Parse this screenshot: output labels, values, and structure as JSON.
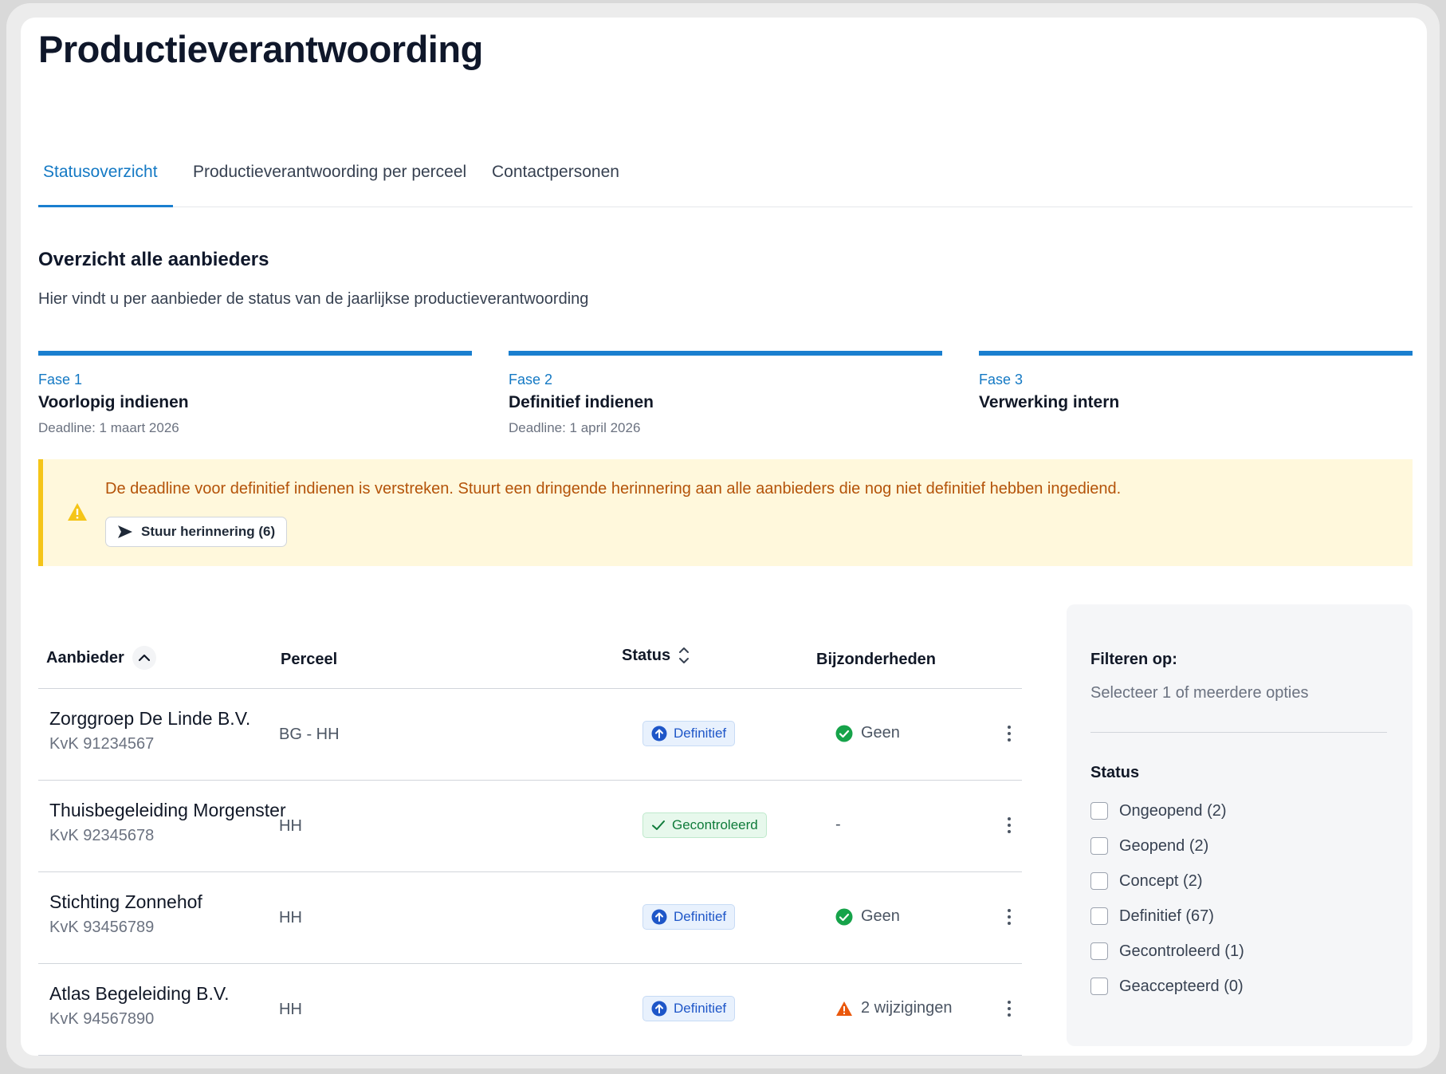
{
  "page": {
    "title": "Productieverantwoording"
  },
  "tabs": [
    {
      "label": "Statusoverzicht",
      "active": true
    },
    {
      "label": "Productieverantwoording per perceel",
      "active": false
    },
    {
      "label": "Contactpersonen",
      "active": false
    }
  ],
  "section": {
    "title": "Overzicht alle aanbieders",
    "subtitle": "Hier vindt u per aanbieder de status van de jaarlijkse productieverantwoording"
  },
  "phases": [
    {
      "label": "Fase 1",
      "name": "Voorlopig indienen",
      "deadline": "Deadline: 1 maart 2026"
    },
    {
      "label": "Fase 2",
      "name": "Definitief indienen",
      "deadline": "Deadline: 1 april 2026"
    },
    {
      "label": "Fase 3",
      "name": "Verwerking intern",
      "deadline": ""
    }
  ],
  "alert": {
    "text": "De deadline voor definitief indienen is verstreken. Stuurt een dringende herinnering aan alle aanbieders die nog niet definitief hebben ingediend.",
    "button_label": "Stuur herinnering (6)"
  },
  "table": {
    "headers": {
      "aanbieder": "Aanbieder",
      "perceel": "Perceel",
      "status": "Status",
      "bijzonderheden": "Bijzonderheden"
    },
    "rows": [
      {
        "name": "Zorggroep De Linde B.V.",
        "kvk": "KvK 91234567",
        "perceel": "BG - HH",
        "status": "Definitief",
        "status_type": "definitief",
        "bijzonderheden": "Geen",
        "bij_type": "ok"
      },
      {
        "name": "Thuisbegeleiding Morgenster",
        "kvk": "KvK 92345678",
        "perceel": "HH",
        "status": "Gecontroleerd",
        "status_type": "gecontroleerd",
        "bijzonderheden": "-",
        "bij_type": "none"
      },
      {
        "name": "Stichting Zonnehof",
        "kvk": "KvK 93456789",
        "perceel": "HH",
        "status": "Definitief",
        "status_type": "definitief",
        "bijzonderheden": "Geen",
        "bij_type": "ok"
      },
      {
        "name": "Atlas Begeleiding B.V.",
        "kvk": "KvK 94567890",
        "perceel": "HH",
        "status": "Definitief",
        "status_type": "definitief",
        "bijzonderheden": "2 wijzigingen",
        "bij_type": "warning"
      }
    ]
  },
  "filter": {
    "title": "Filteren op:",
    "subtitle": "Selecteer 1 of meerdere opties",
    "group_label": "Status",
    "options": [
      {
        "label": "Ongeopend (2)"
      },
      {
        "label": "Geopend (2)"
      },
      {
        "label": "Concept (2)"
      },
      {
        "label": "Definitief (67)"
      },
      {
        "label": "Gecontroleerd (1)"
      },
      {
        "label": "Geaccepteerd (0)"
      }
    ]
  },
  "colors": {
    "accent": "#1a7fcf",
    "alert_bg": "#fff8dc",
    "alert_border": "#f5c518",
    "alert_text": "#b45309",
    "ok_green": "#16a34a",
    "warning_orange": "#ea580c",
    "badge_blue": "#1e56c8"
  },
  "icons": {
    "alert": "warning-triangle-icon",
    "send": "send-arrow-icon",
    "sort_asc": "chevron-up-icon",
    "sort_both": "sort-updown-icon",
    "definitief": "arrow-up-circle-icon",
    "gecontroleerd": "check-icon",
    "ok": "check-circle-icon",
    "warning": "warning-triangle-icon",
    "menu": "kebab-menu-icon"
  }
}
